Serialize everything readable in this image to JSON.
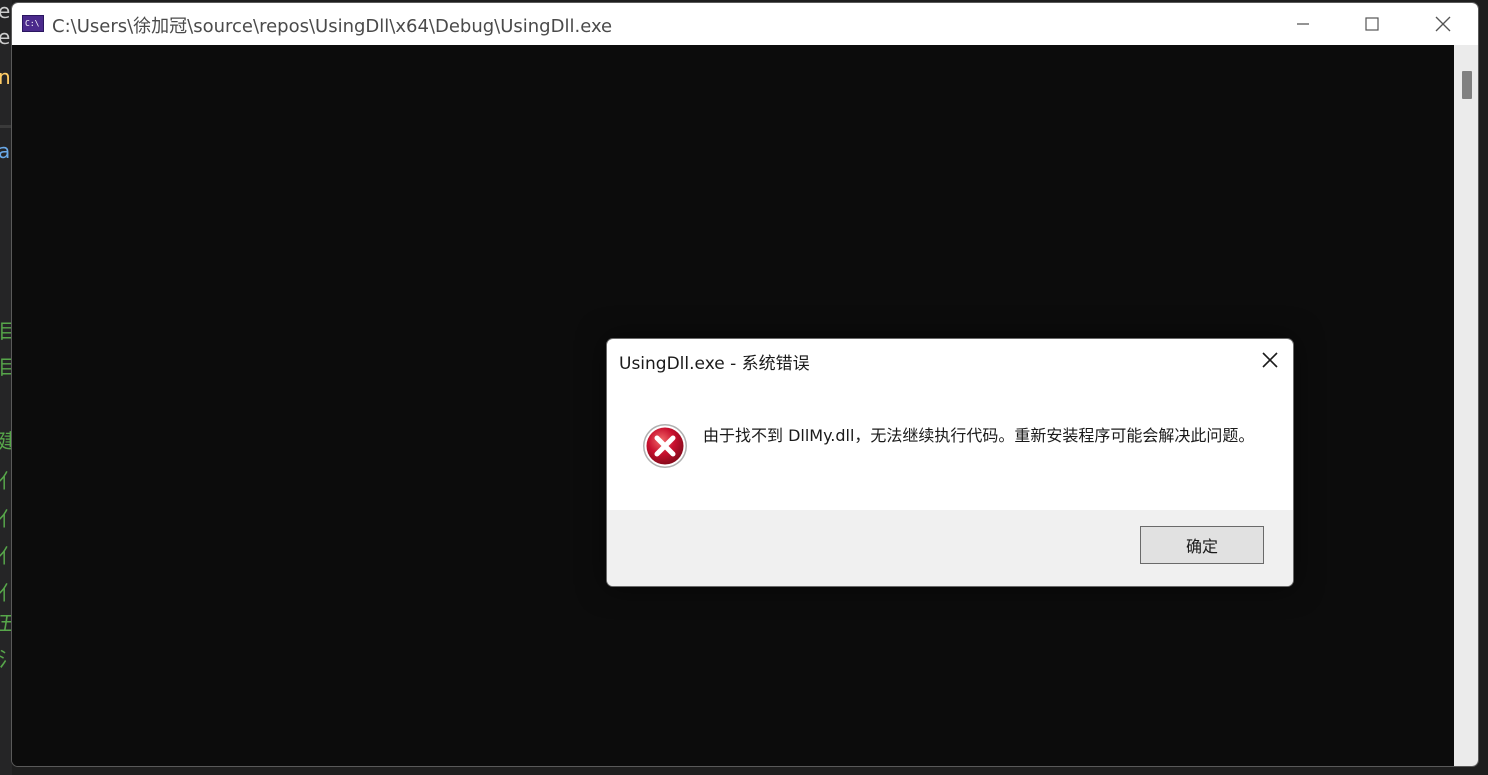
{
  "console_window": {
    "title": "C:\\Users\\徐加冠\\source\\repos\\UsingDll\\x64\\Debug\\UsingDll.exe",
    "icon_text": "C:\\",
    "icon": "console-app-icon",
    "controls": [
      "minimize-icon",
      "maximize-icon",
      "close-icon"
    ]
  },
  "dialog": {
    "title": "UsingDll.exe - 系统错误",
    "message": "由于找不到 DllMy.dll，无法继续执行代码。重新安装程序可能会解决此问题。",
    "icon": "error-icon",
    "ok_label": "确定"
  },
  "colors": {
    "console_background": "#0c0c0c",
    "error_red": "#c8102e",
    "dialog_footer": "#f0f0f0"
  }
}
